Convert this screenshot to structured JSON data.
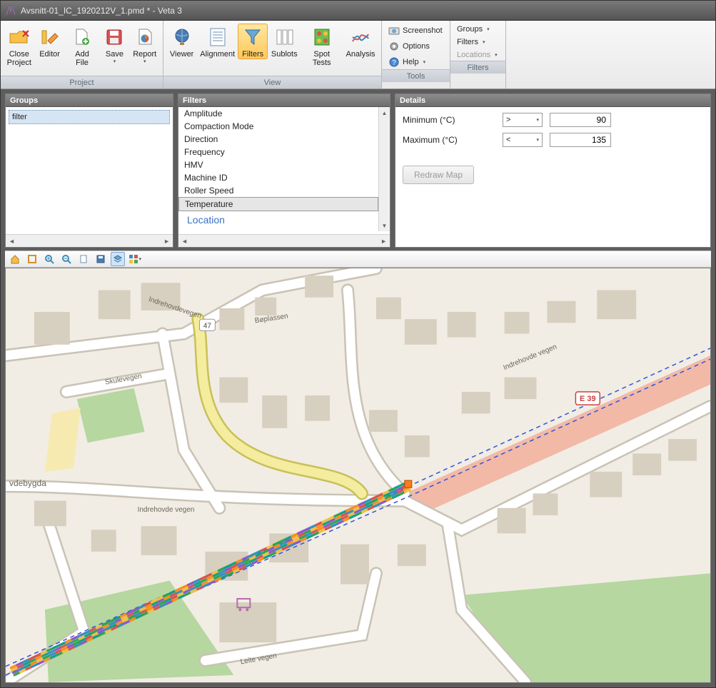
{
  "title": "Avsnitt-01_IC_1920212V_1.pmd * - Veta 3",
  "ribbon": {
    "project": {
      "label": "Project",
      "close": "Close\nProject",
      "editor": "Editor",
      "addfile": "Add File",
      "save": "Save",
      "report": "Report"
    },
    "view": {
      "label": "View",
      "viewer": "Viewer",
      "alignment": "Alignment",
      "filters": "Filters",
      "sublots": "Sublots",
      "spottests": "Spot Tests",
      "analysis": "Analysis"
    },
    "tools": {
      "label": "Tools",
      "screenshot": "Screenshot",
      "options": "Options",
      "help": "Help"
    },
    "filtersgrp": {
      "label": "Filters",
      "groups": "Groups",
      "filters": "Filters",
      "locations": "Locations"
    }
  },
  "panels": {
    "groups": {
      "title": "Groups",
      "item": "filter"
    },
    "filters": {
      "title": "Filters",
      "items": [
        "Amplitude",
        "Compaction Mode",
        "Direction",
        "Frequency",
        "HMV",
        "Machine ID",
        "Roller Speed",
        "Temperature"
      ],
      "selected": "Temperature",
      "location": "Location"
    },
    "details": {
      "title": "Details",
      "min_label": "Minimum (°C)",
      "min_op": ">",
      "min_val": "90",
      "max_label": "Maximum (°C)",
      "max_op": "<",
      "max_val": "135",
      "redraw": "Redraw Map"
    }
  },
  "map": {
    "labels": {
      "indrehovde1": "Indrehovde vegen",
      "indrehovde2": "Indrehovde vegen",
      "indrehovdevegen_top": "Indrehovdevegen",
      "boplassen": "Bøplassen",
      "skulevegen": "Skulevegen",
      "leite": "Leite vegen",
      "place": "vdebygda",
      "e39": "E 39",
      "shield47": "47"
    }
  }
}
